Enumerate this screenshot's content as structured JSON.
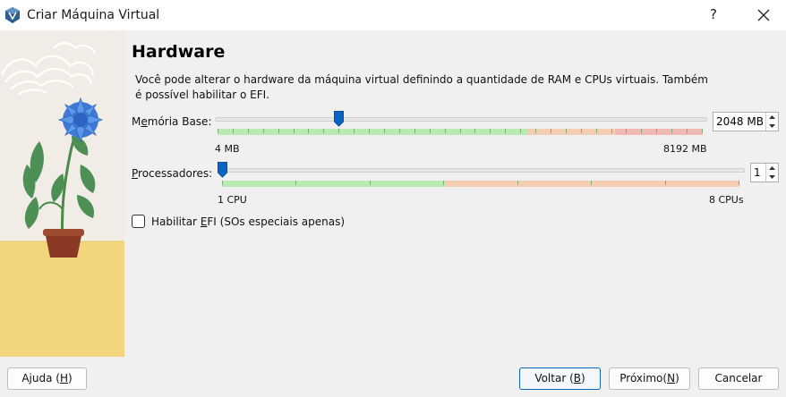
{
  "window": {
    "title": "Criar Máquina Virtual",
    "help_label": "?",
    "icons": {
      "app": "virtualbox-icon",
      "close": "close-icon"
    }
  },
  "page": {
    "heading": "Hardware",
    "description": "Você pode alterar o hardware da máquina virtual definindo a quantidade de RAM e CPUs virtuais. Também é possível habilitar o EFI."
  },
  "memory": {
    "label_pre": "M",
    "label_underline": "e",
    "label_post": "mória Base:",
    "min_label": "4 MB",
    "max_label": "8192 MB",
    "value": "2048 MB",
    "value_mb": 2048,
    "min_mb": 4,
    "max_mb": 8192
  },
  "processors": {
    "label_underline": "P",
    "label_post": "rocessadores:",
    "min_label": "1 CPU",
    "max_label": "8 CPUs",
    "value": "1",
    "value_num": 1,
    "min_num": 1,
    "max_num": 8
  },
  "efi": {
    "label_pre": "Habilitar ",
    "label_underline": "E",
    "label_post": "FI (SOs especiais apenas)",
    "checked": false
  },
  "buttons": {
    "help": {
      "pre": "Ajuda (",
      "u": "H",
      "post": ")"
    },
    "back": {
      "pre": "Voltar (",
      "u": "B",
      "post": ")"
    },
    "next": {
      "pre": "Próximo(",
      "u": "N",
      "post": ")"
    },
    "cancel": "Cancelar"
  },
  "colors": {
    "accent": "#0a64c2",
    "scale_green": "#b9eab3",
    "scale_orange": "#f5cdb5",
    "scale_red": "#f0b9b6"
  }
}
